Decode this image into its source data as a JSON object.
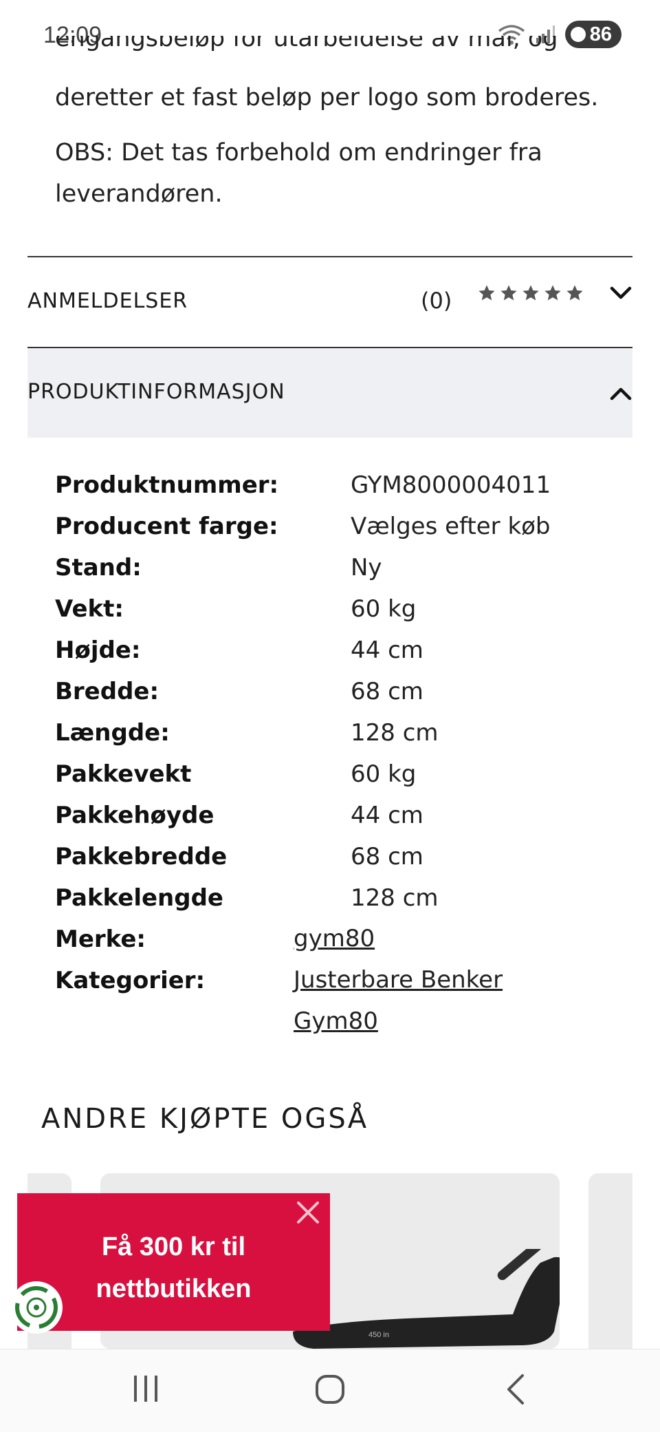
{
  "status_bar": {
    "time": "12:09",
    "battery": "86"
  },
  "description": {
    "line_partial": "engangsbeløp for utarbeidelse av mal, og",
    "line_1": "deretter et fast beløp per logo som broderes.",
    "obs_line_1": "OBS: Det tas forbehold om endringer fra",
    "obs_line_2": "leverandøren."
  },
  "reviews": {
    "label": "ANMELDELSER",
    "count": "(0)",
    "rating_stars": 5
  },
  "product_info": {
    "label": "PRODUKTINFORMASJON",
    "rows": [
      {
        "key": "Produktnummer:",
        "value": "GYM8000004011"
      },
      {
        "key": "Producent farge:",
        "value": "Vælges efter køb"
      },
      {
        "key": "Stand:",
        "value": "Ny"
      },
      {
        "key": "Vekt:",
        "value": "60 kg"
      },
      {
        "key": "Højde:",
        "value": "44 cm"
      },
      {
        "key": "Bredde:",
        "value": "68 cm"
      },
      {
        "key": "Længde:",
        "value": "128 cm"
      },
      {
        "key": "Pakkevekt",
        "value": "60 kg"
      },
      {
        "key": "Pakkehøyde",
        "value": "44 cm"
      },
      {
        "key": "Pakkebredde",
        "value": "68 cm"
      },
      {
        "key": "Pakkelengde",
        "value": "128 cm"
      }
    ],
    "brand_label": "Merke:",
    "brand": "gym80",
    "categories_label": "Kategorier:",
    "categories": [
      "Justerbare Benker",
      "Gym80"
    ]
  },
  "related": {
    "title": "ANDRE KJØPTE OGSÅ",
    "product_badge": "450 in"
  },
  "promo": {
    "line_1": "Få 300 kr til",
    "line_2": "nettbutikken"
  },
  "colors": {
    "accent": "#d8103f",
    "divider": "#333333",
    "panel": "#eff0f3"
  }
}
